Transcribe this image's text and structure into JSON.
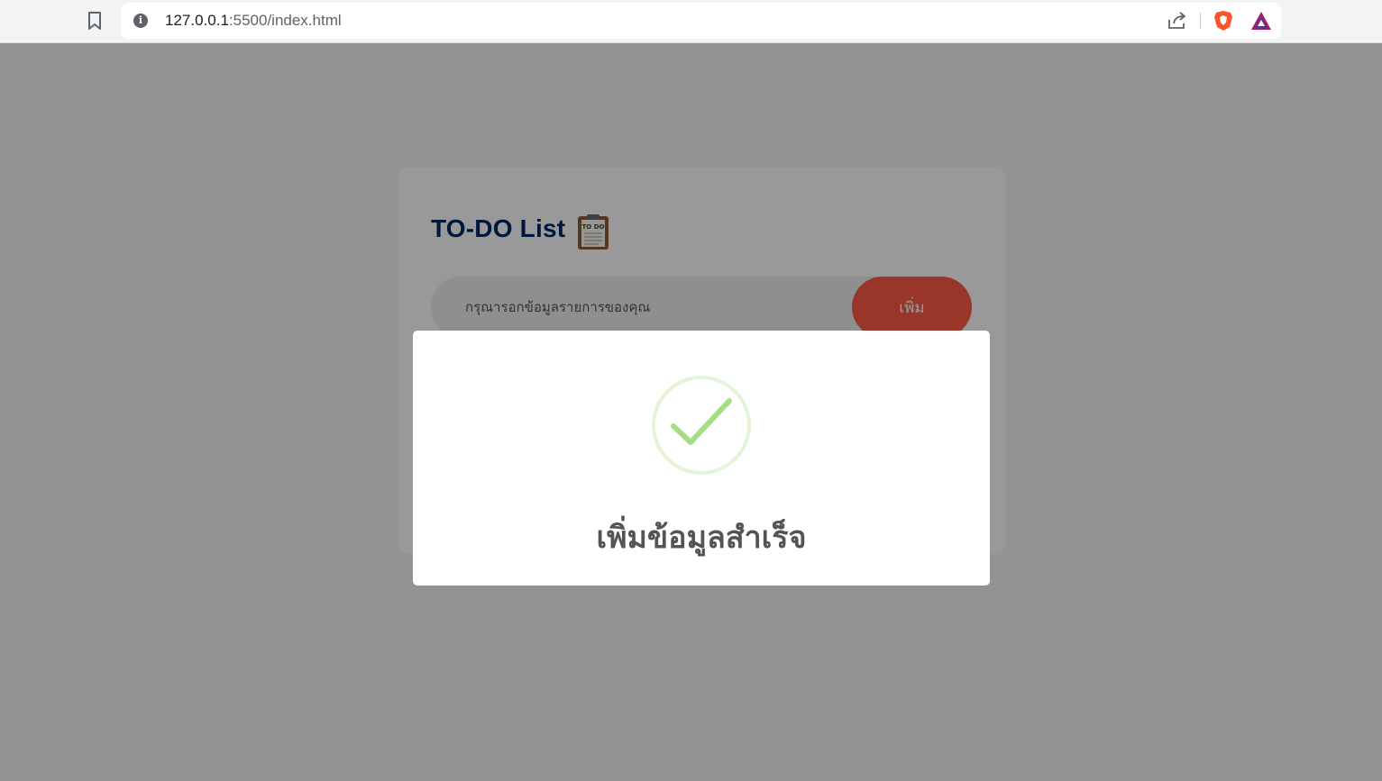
{
  "browser": {
    "url_host": "127.0.0.1",
    "url_rest": ":5500/index.html"
  },
  "todo": {
    "title": "TO-DO List",
    "input_placeholder": "กรุณารอกข้อมูลรายการของคุณ",
    "add_button_label": "เพิ่ม",
    "accent_color": "#ff5945",
    "title_color": "#002765"
  },
  "modal": {
    "icon": "success-check-icon",
    "title": "เพิ่มข้อมูลสำเร็จ",
    "icon_color": "#a5dc86"
  }
}
